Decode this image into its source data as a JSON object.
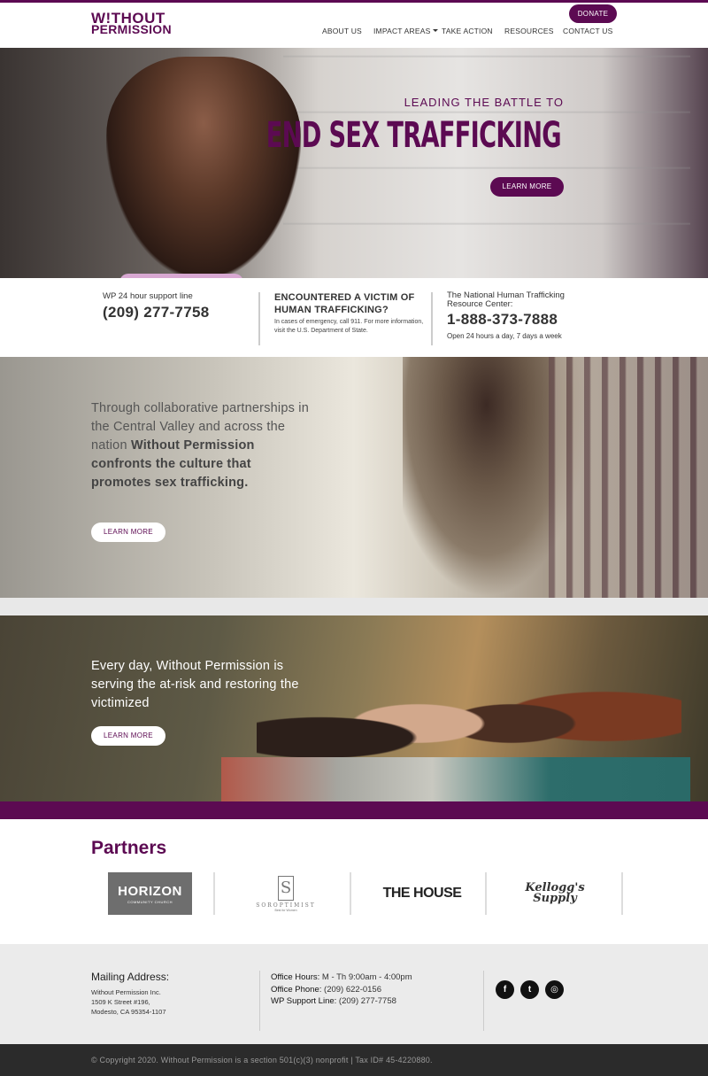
{
  "header": {
    "logo_line1": "W!THOUT",
    "logo_line2": "PERMISSION",
    "donate_label": "DONATE",
    "nav": [
      {
        "label": "ABOUT US"
      },
      {
        "label": "IMPACT AREAS"
      },
      {
        "label": "TAKE ACTION"
      },
      {
        "label": "RESOURCES"
      },
      {
        "label": "CONTACT US"
      }
    ]
  },
  "hero": {
    "subtitle": "LEADING THE BATTLE TO",
    "title": "END SEX TRAFFICKING",
    "button_label": "LEARN MORE"
  },
  "support": {
    "wp_label": "WP 24 hour support line",
    "wp_phone": "(209) 277-7758",
    "victim_heading": "ENCOUNTERED A VICTIM OF HUMAN TRAFFICKING?",
    "victim_note": "In cases of emergency, call 911. For more information, visit the U.S. Department of State.",
    "national_label": "The National Human Trafficking Resource Center:",
    "national_phone": "1-888-373-7888",
    "national_hours": "Open 24 hours a day, 7 days a week"
  },
  "collab": {
    "text_plain": "Through collaborative partnerships in the Central Valley and across the nation ",
    "text_bold": "Without Permission confronts the culture that promotes sex trafficking.",
    "button_label": "LEARN MORE"
  },
  "everyday": {
    "text": "Every day, Without Permission is serving the at-risk and restoring the victimized",
    "button_label": "LEARN MORE"
  },
  "partners": {
    "title": "Partners",
    "horizon_name": "HORIZON",
    "horizon_sub": "COMMUNITY CHURCH",
    "soroptimist_mark": "S",
    "soroptimist_name": "SOROPTIMIST",
    "soroptimist_tag": "Best for Women",
    "thehouse": "THE HOUSE",
    "kellogg_line1": "Kellogg's",
    "kellogg_line2": "Supply"
  },
  "footer": {
    "mailing_heading": "Mailing Address:",
    "address_line1": "Without Permission Inc.",
    "address_line2": "1509 K Street #196,",
    "address_line3": "Modesto, CA 95354-1107",
    "hours_label": "Office Hours:",
    "hours_value": " M - Th 9:00am - 4:00pm",
    "phone_label": "Office Phone:",
    "phone_value": " (209) 622-0156",
    "support_label": "WP Support Line:",
    "support_value": " (209) 277-7758",
    "social": [
      {
        "icon": "facebook-icon",
        "glyph": "f"
      },
      {
        "icon": "twitter-icon",
        "glyph": "t"
      },
      {
        "icon": "instagram-icon",
        "glyph": "◎"
      }
    ]
  },
  "copyright": "© Copyright 2020. Without Permission is a section 501(c)(3) nonprofit | Tax ID# 45-4220880.",
  "colors": {
    "brand_purple": "#5c0a52",
    "footer_bg": "#ebebeb",
    "copyright_bg": "#2b2b2b"
  }
}
